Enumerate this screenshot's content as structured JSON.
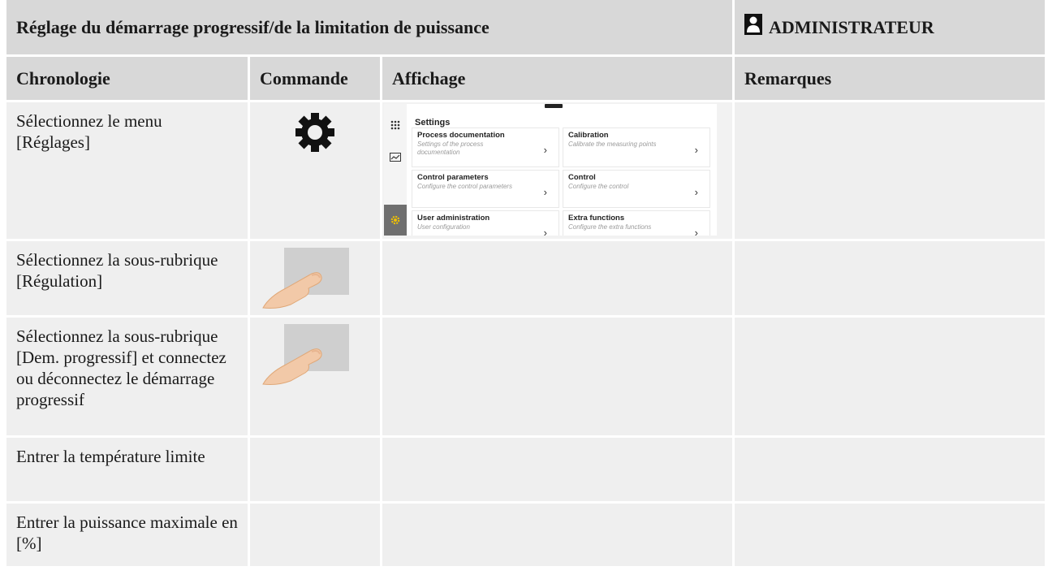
{
  "header": {
    "title": "Réglage du démarrage progressif/de la limitation de puissance",
    "role": "ADMINISTRATEUR"
  },
  "columns": [
    "Chronologie",
    "Commande",
    "Affichage",
    "Remarques"
  ],
  "rows": [
    {
      "step": "Sélectionnez le menu [Réglages]",
      "control_icon": "gear-icon"
    },
    {
      "step": "Sélectionnez la sous-rubrique [Régulation]",
      "control_icon": "finger-tap-icon"
    },
    {
      "step": "Sélectionnez la sous-rubrique [Dem. progressif] et connectez ou déconnectez le démarrage progressif",
      "control_icon": "finger-tap-icon"
    },
    {
      "step": "Entrer la température limite"
    },
    {
      "step": "Entrer la puissance maximale en [%]"
    }
  ],
  "settings_screen": {
    "title": "Settings",
    "tiles": [
      {
        "title": "Process documentation",
        "subtitle": "Settings of the process documentation"
      },
      {
        "title": "Calibration",
        "subtitle": "Calibrate the measuring points"
      },
      {
        "title": "Control parameters",
        "subtitle": "Configure the control parameters"
      },
      {
        "title": "Control",
        "subtitle": "Configure the control"
      },
      {
        "title": "User administration",
        "subtitle": "User configuration"
      },
      {
        "title": "Extra functions",
        "subtitle": "Configure the extra functions"
      }
    ],
    "chevron": "›"
  }
}
